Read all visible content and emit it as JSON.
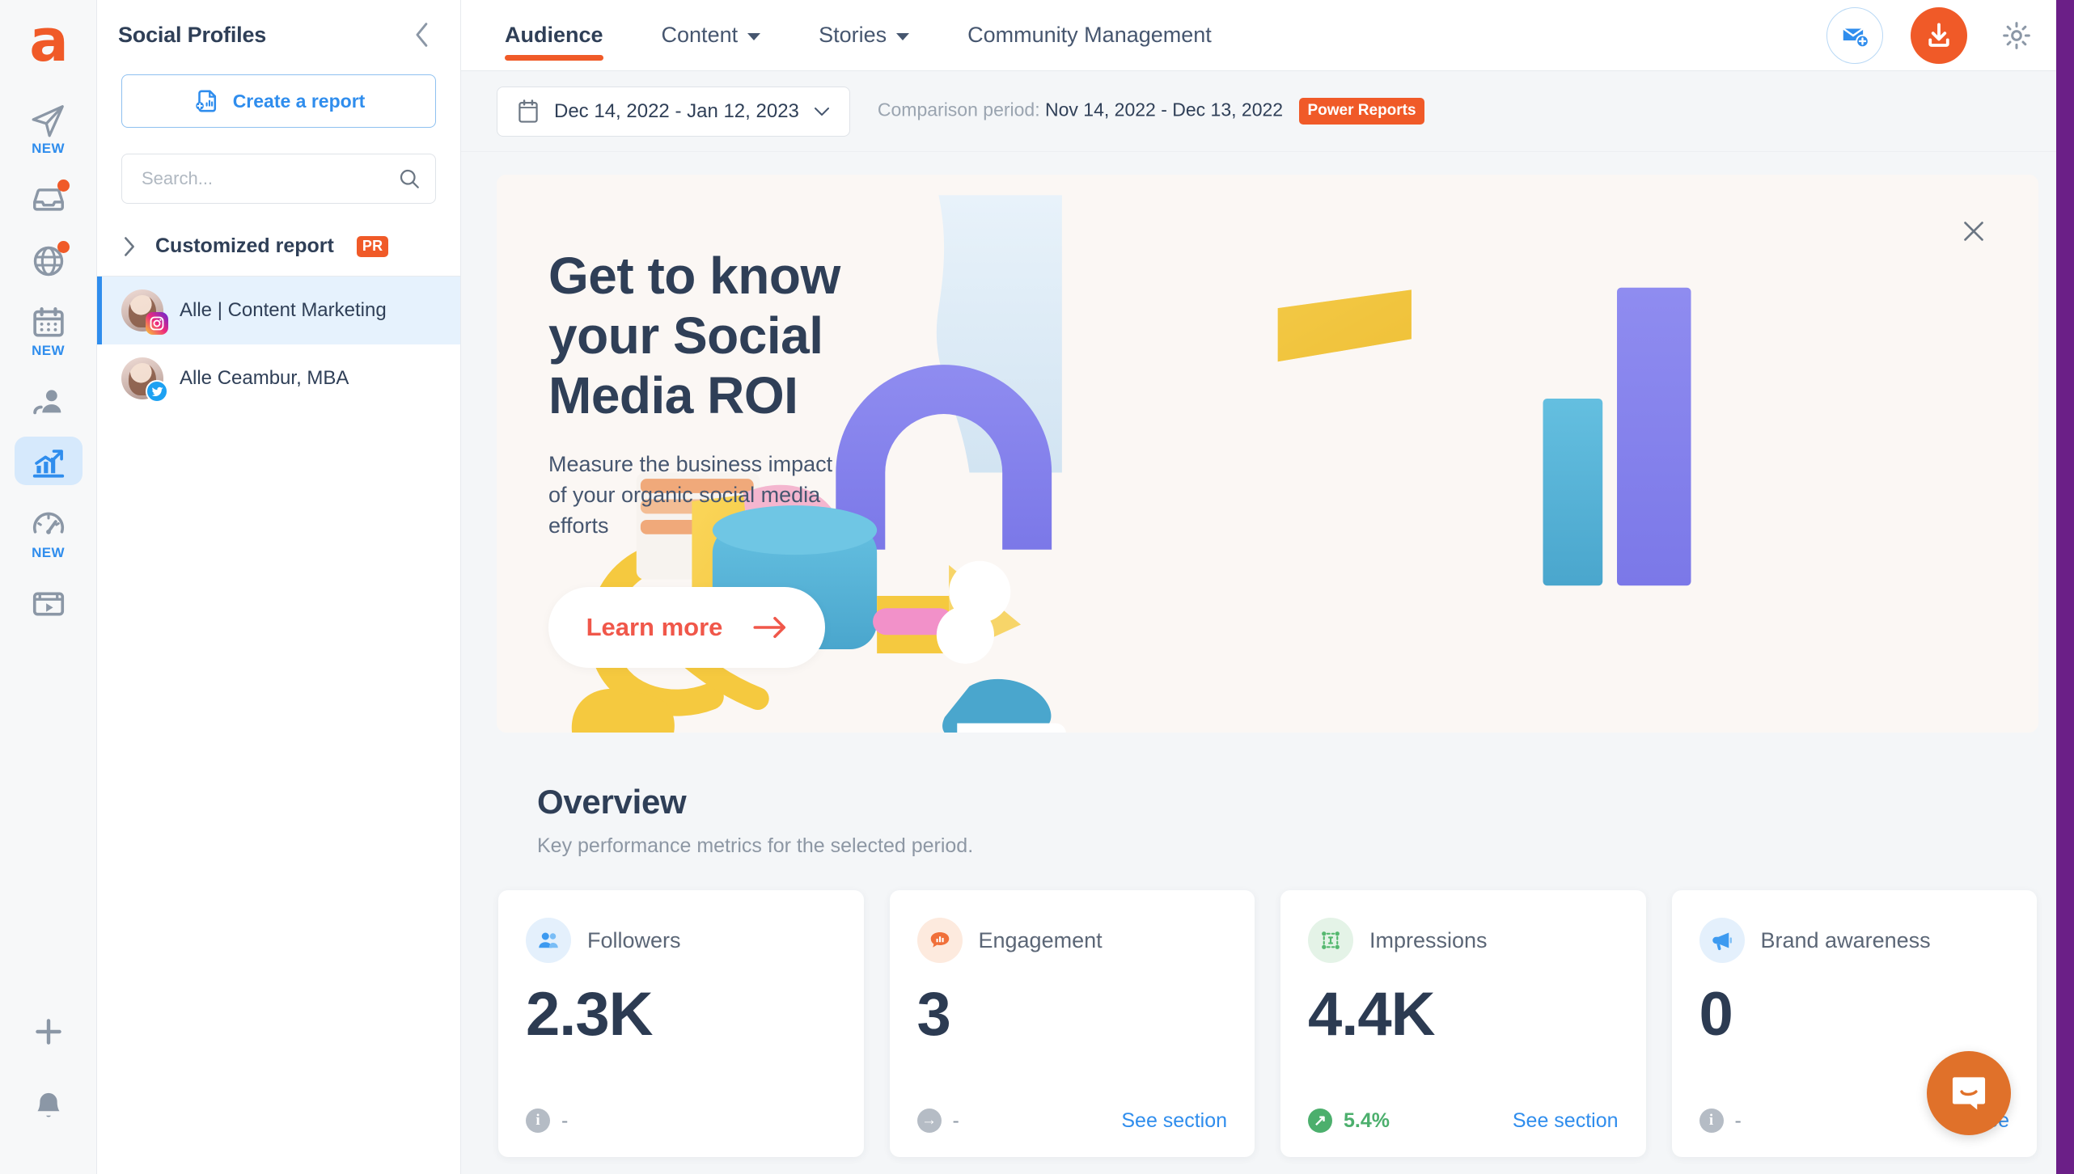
{
  "brand": {
    "logo_letter": "a",
    "accent": "#f05a28",
    "blue": "#2f8ded",
    "navy": "#2f3f57"
  },
  "rail": {
    "items": [
      {
        "name": "publish-icon",
        "badge_text": "NEW",
        "has_dot": false
      },
      {
        "name": "inbox-icon",
        "badge_text": "",
        "has_dot": true
      },
      {
        "name": "listening-icon",
        "badge_text": "",
        "has_dot": true
      },
      {
        "name": "calendar-icon",
        "badge_text": "NEW",
        "has_dot": false
      },
      {
        "name": "influencers-icon",
        "badge_text": "",
        "has_dot": false
      },
      {
        "name": "analytics-icon",
        "badge_text": "",
        "has_dot": false,
        "active": true
      },
      {
        "name": "dashboard-icon",
        "badge_text": "NEW",
        "has_dot": false
      },
      {
        "name": "media-library-icon",
        "badge_text": "",
        "has_dot": false
      }
    ],
    "bottom": [
      {
        "name": "add-icon"
      },
      {
        "name": "notifications-bell-icon"
      }
    ]
  },
  "sidebar": {
    "title": "Social Profiles",
    "collapse_label": "",
    "create_report_label": "Create a report",
    "search": {
      "placeholder": "Search...",
      "value": ""
    },
    "group": {
      "label": "Customized report",
      "badge": "PR"
    },
    "profiles": [
      {
        "name": "Alle | Content Marketing",
        "network": "instagram",
        "selected": true
      },
      {
        "name": "Alle Ceambur, MBA",
        "network": "twitter",
        "selected": false
      }
    ]
  },
  "topnav": {
    "tabs": [
      {
        "label": "Audience",
        "has_caret": false,
        "active": true
      },
      {
        "label": "Content",
        "has_caret": true,
        "active": false
      },
      {
        "label": "Stories",
        "has_caret": true,
        "active": false
      },
      {
        "label": "Community Management",
        "has_caret": false,
        "active": false
      }
    ],
    "actions": [
      {
        "name": "new-message-button"
      },
      {
        "name": "download-report-button"
      },
      {
        "name": "settings-gear-button"
      }
    ]
  },
  "filterbar": {
    "date_range": "Dec 14, 2022 - Jan 12, 2023",
    "comparison_label": "Comparison period:",
    "comparison_range": "Nov 14, 2022 - Dec 13, 2022",
    "power_reports_badge": "Power Reports"
  },
  "hero": {
    "heading": "Get to know your Social Media ROI",
    "subheading": "Measure the business impact of your organic social media efforts",
    "cta_label": "Learn more",
    "close_label": "×"
  },
  "overview": {
    "title": "Overview",
    "subtitle": "Key performance metrics for the selected period."
  },
  "cards": [
    {
      "label": "Followers",
      "value": "2.3K",
      "icon": "followers-icon",
      "icon_bg": "ico-blue",
      "delta_icon": "info-icon",
      "delta_icon_glyph": "i",
      "delta_icon_class": "delta-grey",
      "delta_text": "-",
      "delta_positive": false,
      "link_label": ""
    },
    {
      "label": "Engagement",
      "value": "3",
      "icon": "engagement-icon",
      "icon_bg": "ico-orange",
      "delta_icon": "arrow-right-icon",
      "delta_icon_glyph": "→",
      "delta_icon_class": "delta-grey",
      "delta_text": "-",
      "delta_positive": false,
      "link_label": "See section"
    },
    {
      "label": "Impressions",
      "value": "4.4K",
      "icon": "impressions-icon",
      "icon_bg": "ico-green",
      "delta_icon": "arrow-up-right-icon",
      "delta_icon_glyph": "↗",
      "delta_icon_class": "delta-green",
      "delta_text": "5.4%",
      "delta_positive": true,
      "link_label": "See section"
    },
    {
      "label": "Brand awareness",
      "value": "0",
      "icon": "brand-awareness-icon",
      "icon_bg": "ico-blue",
      "delta_icon": "info-icon",
      "delta_icon_glyph": "i",
      "delta_icon_class": "delta-grey",
      "delta_text": "-",
      "delta_positive": false,
      "link_label": "See"
    }
  ],
  "support": {
    "launcher_name": "intercom-chat-launcher"
  }
}
